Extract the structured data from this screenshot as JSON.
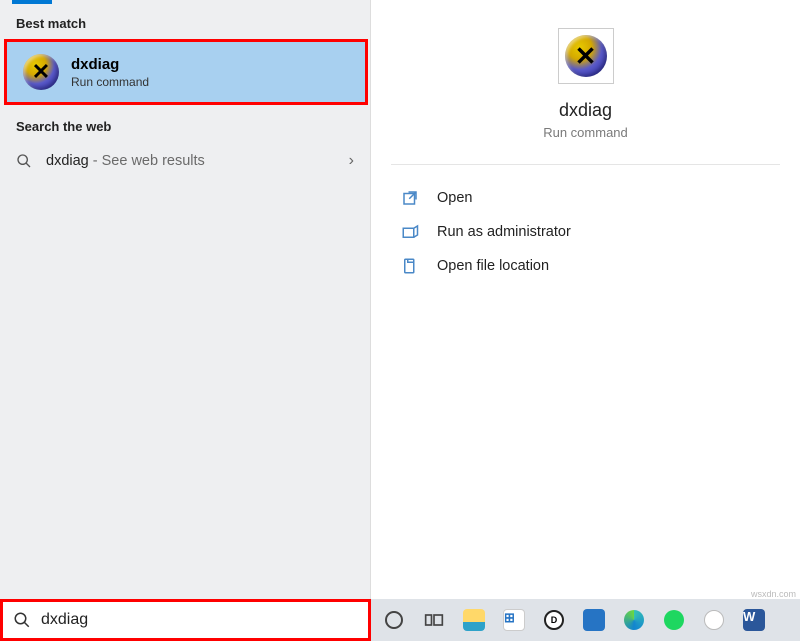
{
  "left": {
    "section_best_match": "Best match",
    "best_match": {
      "title": "dxdiag",
      "subtitle": "Run command"
    },
    "section_web": "Search the web",
    "web_result": {
      "term": "dxdiag",
      "hint": " - See web results"
    }
  },
  "right": {
    "title": "dxdiag",
    "subtitle": "Run command",
    "actions": {
      "open": "Open",
      "run_admin": "Run as administrator",
      "open_loc": "Open file location"
    }
  },
  "search": {
    "value": "dxdiag"
  },
  "watermark": "wsxdn.com"
}
